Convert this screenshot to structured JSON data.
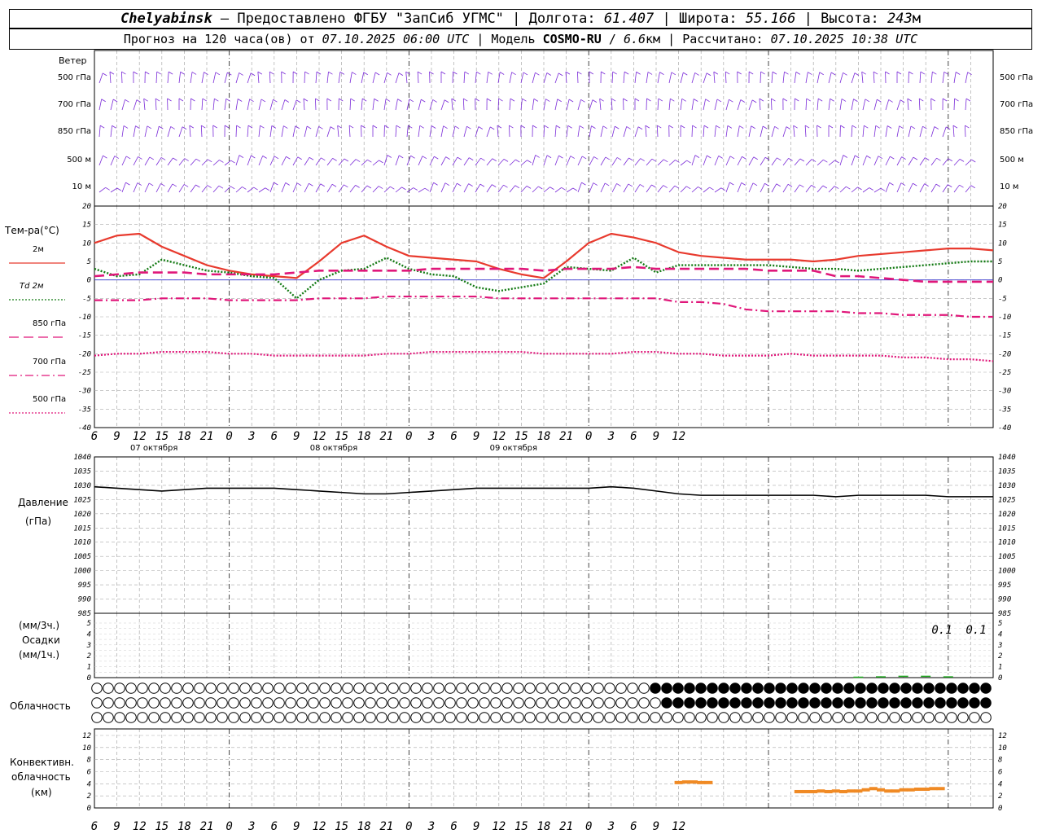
{
  "header": {
    "station": "Chelyabinsk",
    "dash": "–",
    "provider": "Предоставлено ФГБУ \"ЗапСиб УГМС\"",
    "lon_label": "Долгота:",
    "lon": "61.407",
    "lat_label": "Широта:",
    "lat": "55.166",
    "alt_label": "Высота:",
    "alt": "243",
    "alt_unit": "м",
    "forecast_label": "Прогноз на 120 часа(ов) от",
    "forecast_start": "07.10.2025 06:00 UTC",
    "model_label": "Модель",
    "model": "COSMO-RU",
    "resolution": "6.6",
    "res_unit": "км",
    "calc_label": "Рассчитано:",
    "calc_time": "07.10.2025 10:38 UTC",
    "sep": "|"
  },
  "labels": {
    "wind": "Ветер",
    "wind_levels": [
      "500 гПа",
      "700 гПа",
      "850 гПа",
      "500  м",
      "10  м"
    ],
    "temp": "Тем-ра(°С)",
    "temp_legend": [
      "2м",
      "Td  2м",
      "850 гПа",
      "700 гПа",
      "500 гПа"
    ],
    "pressure": "Давление",
    "pressure_unit": "(гПа)",
    "precip_top": "(мм/3ч.)",
    "precip": "Осадки",
    "precip_bot": "(мм/1ч.)",
    "cloud": "Облачность",
    "conv1": "Конвективн.",
    "conv2": "облачность",
    "conv3": "(км)"
  },
  "x_ticks": [
    "6",
    "9",
    "12",
    "15",
    "18",
    "21",
    "0",
    "3",
    "6",
    "9",
    "12",
    "15",
    "18",
    "21",
    "0",
    "3",
    "6",
    "9",
    "12",
    "15",
    "18",
    "21",
    "0",
    "3",
    "6",
    "9",
    "12"
  ],
  "date_labels": [
    "07 октября",
    "08 октября",
    "09 октября"
  ],
  "precip_annotations": [
    "0.1",
    "0.1"
  ],
  "colors": {
    "t2m": "#e83a2e",
    "td2m": "#137a13",
    "t850": "#e0177a",
    "t700": "#e0177a",
    "t500": "#e0177a",
    "wind": "#7a2ad8",
    "pressure": "#000000",
    "precip": "#22aa22",
    "conv": "#f08a24",
    "zero_line": "#3333cc"
  },
  "chart_data": [
    {
      "type": "line",
      "title": "Тем-ра(°С)",
      "x": [
        -18,
        -15,
        -12,
        -9,
        -6,
        -3,
        0,
        3,
        6,
        9,
        12,
        15,
        18,
        21,
        24,
        27,
        30,
        33,
        36,
        39,
        42,
        45,
        48,
        51,
        54,
        57,
        60,
        63,
        66,
        69,
        72,
        75,
        78,
        81,
        84,
        87,
        90,
        93,
        96,
        99,
        102
      ],
      "ylim": [
        -40,
        20
      ],
      "series": [
        {
          "name": "2м",
          "values": [
            10,
            12,
            12.5,
            9,
            6.5,
            4,
            2.5,
            1.5,
            1,
            0.5,
            5,
            10,
            12,
            9,
            6.5,
            6,
            5.5,
            5,
            3,
            1.5,
            0.5,
            5,
            10,
            12.5,
            11.5,
            10,
            7.5,
            6.5,
            6,
            5.5,
            5.5,
            5.5,
            5,
            5.5,
            6.5,
            7,
            7.5,
            8,
            8.5,
            8.5,
            8
          ]
        },
        {
          "name": "Td  2м",
          "values": [
            3,
            1,
            1.5,
            5.5,
            4,
            2.5,
            2,
            1,
            0.5,
            -5,
            0,
            2.5,
            3,
            6,
            3,
            1.5,
            1,
            -2,
            -3,
            -2,
            -1,
            3.5,
            3,
            2.5,
            6,
            2,
            4,
            4,
            4,
            4,
            4,
            3.5,
            3,
            3,
            2.5,
            3,
            3.5,
            4,
            4.5,
            5,
            5
          ]
        },
        {
          "name": "850 гПа",
          "values": [
            1,
            1.5,
            2,
            2,
            2,
            1.5,
            1.5,
            1.5,
            1.5,
            2,
            2.5,
            2.5,
            2.5,
            2.5,
            2.5,
            3,
            3,
            3,
            3,
            3,
            2.5,
            3,
            3,
            3,
            3.5,
            3,
            3,
            3,
            3,
            3,
            2.5,
            2.5,
            2.5,
            1,
            1,
            0.5,
            0,
            -0.5,
            -0.5,
            -0.5,
            -0.5
          ]
        },
        {
          "name": "700 гПа",
          "values": [
            -5.5,
            -5.5,
            -5.5,
            -5,
            -5,
            -5,
            -5.5,
            -5.5,
            -5.5,
            -5.5,
            -5,
            -5,
            -5,
            -4.5,
            -4.5,
            -4.5,
            -4.5,
            -4.5,
            -5,
            -5,
            -5,
            -5,
            -5,
            -5,
            -5,
            -5,
            -6,
            -6,
            -6.5,
            -8,
            -8.5,
            -8.5,
            -8.5,
            -8.5,
            -9,
            -9,
            -9.5,
            -9.5,
            -9.5,
            -10,
            -10
          ]
        },
        {
          "name": "500 гПа",
          "values": [
            -20.5,
            -20,
            -20,
            -19.5,
            -19.5,
            -19.5,
            -20,
            -20,
            -20.5,
            -20.5,
            -20.5,
            -20.5,
            -20.5,
            -20,
            -20,
            -19.5,
            -19.5,
            -19.5,
            -19.5,
            -19.5,
            -20,
            -20,
            -20,
            -20,
            -19.5,
            -19.5,
            -20,
            -20,
            -20.5,
            -20.5,
            -20.5,
            -20,
            -20.5,
            -20.5,
            -20.5,
            -20.5,
            -21,
            -21,
            -21.5,
            -21.5,
            -22
          ]
        }
      ]
    },
    {
      "type": "line",
      "title": "Давление",
      "x": [
        -18,
        -15,
        -12,
        -9,
        -6,
        -3,
        0,
        3,
        6,
        9,
        12,
        15,
        18,
        21,
        24,
        27,
        30,
        33,
        36,
        39,
        42,
        45,
        48,
        51,
        54,
        57,
        60,
        63,
        66,
        69,
        72,
        75,
        78,
        81,
        84,
        87,
        90,
        93,
        96,
        99,
        102
      ],
      "ylim": [
        985,
        1040
      ],
      "series": [
        {
          "name": "Давление",
          "values": [
            1029.5,
            1029,
            1028.5,
            1028,
            1028.5,
            1029,
            1029,
            1029,
            1029,
            1028.5,
            1028,
            1027.5,
            1027,
            1027,
            1027.5,
            1028,
            1028.5,
            1029,
            1029,
            1029,
            1029,
            1029,
            1029,
            1029.5,
            1029,
            1028,
            1027,
            1026.5,
            1026.5,
            1026.5,
            1026.5,
            1026.5,
            1026.5,
            1026,
            1026.5,
            1026.5,
            1026.5,
            1026.5,
            1026,
            1026,
            1026
          ]
        }
      ]
    },
    {
      "type": "bar",
      "title": "Осадки",
      "x": [
        84,
        87,
        90,
        93,
        96
      ],
      "ylim": [
        0,
        5.5
      ],
      "series": [
        {
          "name": "Осадки",
          "values": [
            0.02,
            0.05,
            0.1,
            0.1,
            0.05
          ]
        }
      ]
    },
    {
      "type": "bar",
      "title": "Конвективн. облачность",
      "x": [
        60,
        61,
        62,
        63,
        64,
        76,
        77,
        78,
        79,
        80,
        81,
        82,
        83,
        84,
        85,
        86,
        87,
        88,
        89,
        90,
        91,
        92,
        93,
        94,
        95
      ],
      "ylim": [
        0,
        14
      ],
      "series": [
        {
          "name": "Конвективн. облачность",
          "values": [
            4.2,
            4.3,
            4.3,
            4.2,
            4.2,
            2.7,
            2.7,
            2.7,
            2.8,
            2.7,
            2.8,
            2.7,
            2.8,
            2.8,
            3,
            3.2,
            3,
            2.8,
            2.8,
            3,
            3,
            3.1,
            3.1,
            3.2,
            3.2
          ]
        }
      ]
    }
  ]
}
